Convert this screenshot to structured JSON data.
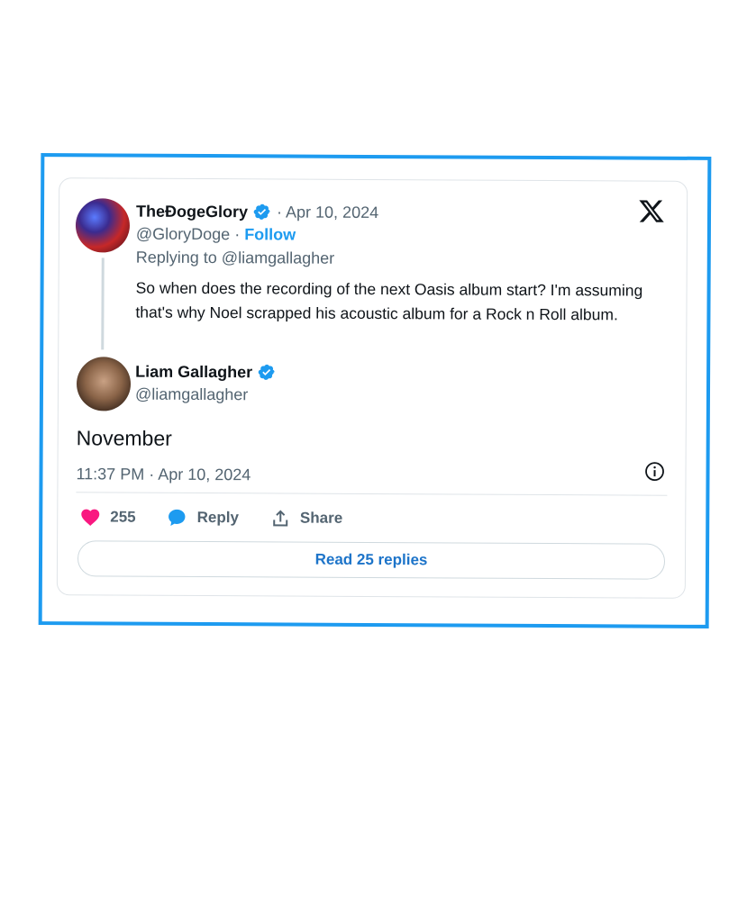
{
  "parent_tweet": {
    "author_name": "TheĐogeGlory",
    "date": "· Apr 10, 2024",
    "handle": "@GloryDoge",
    "separator": " · ",
    "follow_label": "Follow",
    "replying_to": "Replying to @liamgallagher",
    "text": "So when does the recording of the next Oasis album start? I'm assuming that's why Noel scrapped his acoustic album for a Rock n Roll album."
  },
  "reply_tweet": {
    "author_name": "Liam Gallagher",
    "handle": "@liamgallagher",
    "text": "November",
    "timestamp": "11:37 PM · Apr 10, 2024"
  },
  "actions": {
    "like_count": "255",
    "reply_label": "Reply",
    "share_label": "Share"
  },
  "read_replies_label": "Read 25 replies",
  "colors": {
    "accent": "#1d9bf0",
    "like": "#f91880",
    "frame_border": "#1d9bf0"
  },
  "icons": {
    "logo": "x-logo-icon",
    "verified": "verified-badge-icon",
    "info": "info-icon",
    "like": "heart-icon",
    "reply": "reply-bubble-icon",
    "share": "share-icon"
  }
}
